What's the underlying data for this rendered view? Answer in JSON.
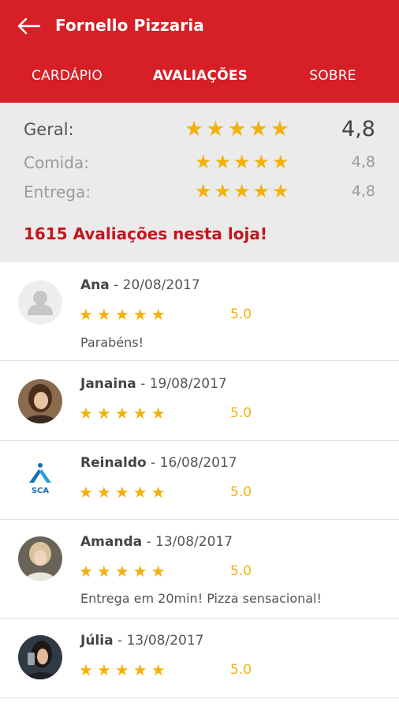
{
  "header": {
    "title": "Fornello Pizzaria"
  },
  "tabs": [
    {
      "label": "CARDÁPIO"
    },
    {
      "label": "AVALIAÇÕES"
    },
    {
      "label": "SOBRE"
    }
  ],
  "summary": {
    "rows": [
      {
        "label": "Geral:",
        "stars": "★★★★★",
        "value": "4,8"
      },
      {
        "label": "Comida:",
        "stars": "★★★★★",
        "value": "4,8"
      },
      {
        "label": "Entrega:",
        "stars": "★★★★★",
        "value": "4,8"
      }
    ],
    "count_text": "1615 Avaliações nesta loja!"
  },
  "reviews": [
    {
      "name": "Ana",
      "date": " - 20/08/2017",
      "stars": "★★★★★",
      "rating": "5.0",
      "comment": "Parabéns!"
    },
    {
      "name": "Janaina",
      "date": " - 19/08/2017",
      "stars": "★★★★★",
      "rating": "5.0",
      "comment": ""
    },
    {
      "name": "Reinaldo",
      "date": " - 16/08/2017",
      "stars": "★★★★★",
      "rating": "5.0",
      "comment": "",
      "avatar_text": "SCA"
    },
    {
      "name": "Amanda",
      "date": " - 13/08/2017",
      "stars": "★★★★★",
      "rating": "5.0",
      "comment": "Entrega em 20min! Pizza sensacional!"
    },
    {
      "name": "Júlia",
      "date": " - 13/08/2017",
      "stars": "★★★★★",
      "rating": "5.0",
      "comment": ""
    }
  ],
  "colors": {
    "brand": "#d61f26",
    "star": "#f2b20c",
    "count": "#c4151c"
  }
}
